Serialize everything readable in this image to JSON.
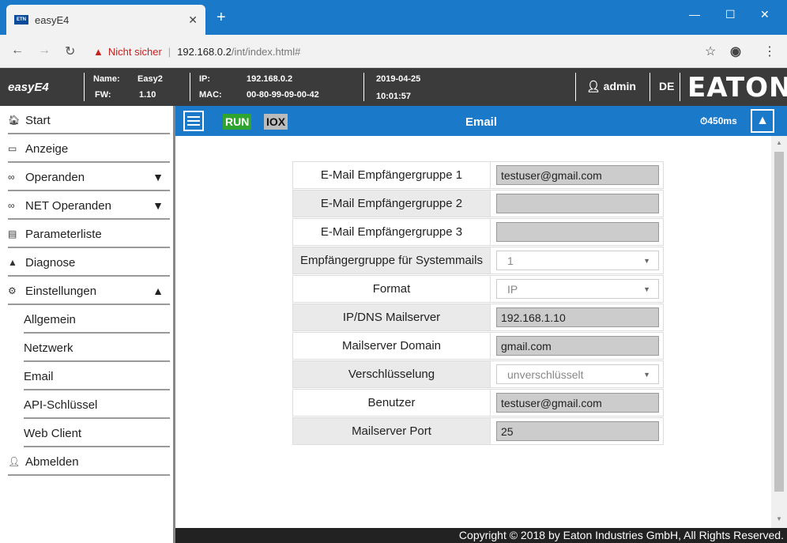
{
  "browser": {
    "tab_title": "easyE4",
    "favicon_text": "ETN",
    "not_secure": "Nicht sicher",
    "url_host": "192.168.0.2",
    "url_path": "/int/index.html#"
  },
  "header": {
    "brand": "easyE4",
    "name_label": "Name:",
    "name_value": "Easy2",
    "fw_label": "FW:",
    "fw_value": "1.10",
    "ip_label": "IP:",
    "ip_value": "192.168.0.2",
    "mac_label": "MAC:",
    "mac_value": "00-80-99-09-00-42",
    "date": "2019-04-25",
    "time": "10:01:57",
    "user": "admin",
    "language": "DE",
    "logo": "EATON"
  },
  "sidebar": {
    "items": [
      {
        "label": "Start",
        "icon": "home-icon"
      },
      {
        "label": "Anzeige",
        "icon": "monitor-icon"
      },
      {
        "label": "Operanden",
        "icon": "glasses-icon"
      },
      {
        "label": "NET Operanden",
        "icon": "glasses-icon"
      },
      {
        "label": "Parameterliste",
        "icon": "list-icon"
      },
      {
        "label": "Diagnose",
        "icon": "warning-icon"
      },
      {
        "label": "Einstellungen",
        "icon": "gear-icon"
      }
    ],
    "subitems": [
      "Allgemein",
      "Netzwerk",
      "Email",
      "API-Schlüssel",
      "Web Client"
    ],
    "logout": "Abmelden"
  },
  "toolbar": {
    "run": "RUN",
    "iox": "IOX",
    "title": "Email",
    "cycle": "450ms"
  },
  "form": {
    "rows": [
      {
        "label": "E-Mail Empfängergruppe 1",
        "value": "testuser@gmail.com",
        "type": "input"
      },
      {
        "label": "E-Mail Empfängergruppe 2",
        "value": "",
        "type": "input"
      },
      {
        "label": "E-Mail Empfängergruppe 3",
        "value": "",
        "type": "input"
      },
      {
        "label": "Empfängergruppe für Systemmails",
        "value": "1",
        "type": "select"
      },
      {
        "label": "Format",
        "value": "IP",
        "type": "select"
      },
      {
        "label": "IP/DNS Mailserver",
        "value": "192.168.1.10",
        "type": "input"
      },
      {
        "label": "Mailserver Domain",
        "value": "gmail.com",
        "type": "input"
      },
      {
        "label": "Verschlüsselung",
        "value": "unverschlüsselt",
        "type": "select"
      },
      {
        "label": "Benutzer",
        "value": "testuser@gmail.com",
        "type": "input"
      },
      {
        "label": "Mailserver Port",
        "value": "25",
        "type": "input"
      }
    ]
  },
  "footer": "Copyright © 2018 by Eaton Industries GmbH, All Rights Reserved."
}
